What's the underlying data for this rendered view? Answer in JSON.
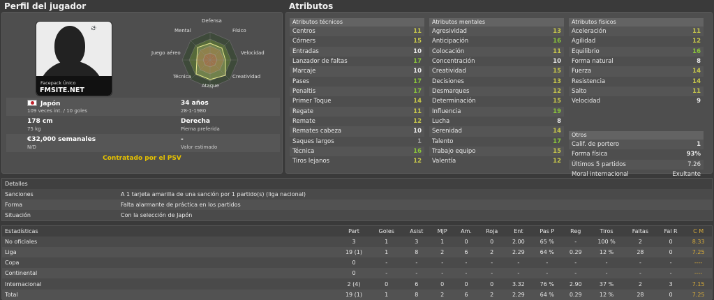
{
  "profile": {
    "title": "Perfil del jugador",
    "photo": {
      "caption_small": "Facepack  Único",
      "caption_big": "FMSITE.NET"
    },
    "radar": {
      "labels": {
        "defensa": "Defensa",
        "fisico": "Físico",
        "velocidad": "Velocidad",
        "creatividad": "Creatividad",
        "ataque": "Ataque",
        "tecnica": "Técnica",
        "juego_aereo": "Juego aéreo",
        "mental": "Mental"
      }
    },
    "nationality": "Japón",
    "caps": "109 veces int. / 10 goles",
    "age": "34 años",
    "birthdate": "28-1-1980",
    "height": "178 cm",
    "weight": "75 kg",
    "foot": "Derecha",
    "foot_label": "Pierna preferida",
    "wage": "€32,000 semanales",
    "wage_sub": "N/D",
    "value": "-",
    "value_label": "Valor estimado",
    "contract": "Contratado por el PSV"
  },
  "attributes": {
    "title": "Atributos",
    "technical": {
      "header": "Atributos técnicos",
      "items": [
        {
          "name": "Centros",
          "value": "11",
          "color": "#c8c84a"
        },
        {
          "name": "Córners",
          "value": "15",
          "color": "#c8c84a"
        },
        {
          "name": "Entradas",
          "value": "10",
          "color": "#e8e8e8"
        },
        {
          "name": "Lanzador de faltas",
          "value": "17",
          "color": "#8ac43a"
        },
        {
          "name": "Marcaje",
          "value": "10",
          "color": "#e8e8e8"
        },
        {
          "name": "Pases",
          "value": "17",
          "color": "#8ac43a"
        },
        {
          "name": "Penaltis",
          "value": "17",
          "color": "#8ac43a"
        },
        {
          "name": "Primer Toque",
          "value": "14",
          "color": "#c8c84a"
        },
        {
          "name": "Regate",
          "value": "11",
          "color": "#c8c84a"
        },
        {
          "name": "Remate",
          "value": "12",
          "color": "#c8c84a"
        },
        {
          "name": "Remates cabeza",
          "value": "10",
          "color": "#e8e8e8"
        },
        {
          "name": "Saques largos",
          "value": "1",
          "color": "#a0a0a0"
        },
        {
          "name": "Técnica",
          "value": "16",
          "color": "#8ac43a"
        },
        {
          "name": "Tiros lejanos",
          "value": "12",
          "color": "#c8c84a"
        }
      ]
    },
    "mental": {
      "header": "Atributos mentales",
      "items": [
        {
          "name": "Agresividad",
          "value": "13",
          "color": "#c8c84a"
        },
        {
          "name": "Anticipación",
          "value": "16",
          "color": "#8ac43a"
        },
        {
          "name": "Colocación",
          "value": "11",
          "color": "#c8c84a"
        },
        {
          "name": "Concentración",
          "value": "10",
          "color": "#e8e8e8"
        },
        {
          "name": "Creatividad",
          "value": "15",
          "color": "#c8c84a"
        },
        {
          "name": "Decisiones",
          "value": "13",
          "color": "#c8c84a"
        },
        {
          "name": "Desmarques",
          "value": "12",
          "color": "#c8c84a"
        },
        {
          "name": "Determinación",
          "value": "15",
          "color": "#c8c84a"
        },
        {
          "name": "Influencia",
          "value": "19",
          "color": "#8ac43a"
        },
        {
          "name": "Lucha",
          "value": "8",
          "color": "#e8e8e8"
        },
        {
          "name": "Serenidad",
          "value": "14",
          "color": "#c8c84a"
        },
        {
          "name": "Talento",
          "value": "17",
          "color": "#8ac43a"
        },
        {
          "name": "Trabajo equipo",
          "value": "15",
          "color": "#c8c84a"
        },
        {
          "name": "Valentía",
          "value": "12",
          "color": "#c8c84a"
        }
      ]
    },
    "physical": {
      "header": "Atributos físicos",
      "items": [
        {
          "name": "Aceleración",
          "value": "11",
          "color": "#c8c84a"
        },
        {
          "name": "Agilidad",
          "value": "12",
          "color": "#c8c84a"
        },
        {
          "name": "Equilibrio",
          "value": "16",
          "color": "#8ac43a"
        },
        {
          "name": "Forma natural",
          "value": "8",
          "color": "#e8e8e8"
        },
        {
          "name": "Fuerza",
          "value": "14",
          "color": "#c8c84a"
        },
        {
          "name": "Resistencia",
          "value": "14",
          "color": "#c8c84a"
        },
        {
          "name": "Salto",
          "value": "11",
          "color": "#c8c84a"
        },
        {
          "name": "Velocidad",
          "value": "9",
          "color": "#e8e8e8"
        }
      ]
    },
    "others": {
      "header": "Otros",
      "items": [
        {
          "name": "Calif. de portero",
          "value": "1"
        },
        {
          "name": "Forma física",
          "value": "93%"
        },
        {
          "name": "Últimos 5 partidos",
          "value": "7.26"
        },
        {
          "name": "Moral internacional",
          "value": "Exultante"
        }
      ]
    }
  },
  "details": {
    "header": "Detalles",
    "rows": [
      {
        "key": "Sanciones",
        "value": "A 1 tarjeta amarilla de una sanción por 1 partido(s) (liga nacional)"
      },
      {
        "key": "Forma",
        "value": "Falta alarmante de práctica en los partidos"
      },
      {
        "key": "Situación",
        "value": "Con la selección de Japón"
      }
    ]
  },
  "stats": {
    "columns": [
      "Estadísticas",
      "Part",
      "Goles",
      "Asist",
      "MJP",
      "Am.",
      "Roja",
      "Ent",
      "Pas P",
      "Reg",
      "Tiros",
      "Faltas",
      "Fal R",
      "C M"
    ],
    "rows": [
      [
        "No oficiales",
        "3",
        "1",
        "3",
        "1",
        "0",
        "0",
        "2.00",
        "65 %",
        "-",
        "100 %",
        "2",
        "0",
        "8.33"
      ],
      [
        "Liga",
        "19 (1)",
        "1",
        "8",
        "2",
        "6",
        "2",
        "2.29",
        "64 %",
        "0.29",
        "12 %",
        "28",
        "0",
        "7.25"
      ],
      [
        "Copa",
        "0",
        "-",
        "-",
        "-",
        "-",
        "-",
        "-",
        "-",
        "-",
        "-",
        "-",
        "-",
        "----"
      ],
      [
        "Continental",
        "0",
        "-",
        "-",
        "-",
        "-",
        "-",
        "-",
        "-",
        "-",
        "-",
        "-",
        "-",
        "----"
      ],
      [
        "Internacional",
        "2 (4)",
        "0",
        "6",
        "0",
        "0",
        "0",
        "3.32",
        "76 %",
        "2.90",
        "37 %",
        "2",
        "3",
        "7.15"
      ],
      [
        "Total",
        "19 (1)",
        "1",
        "8",
        "2",
        "6",
        "2",
        "2.29",
        "64 %",
        "0.29",
        "12 %",
        "28",
        "0",
        "7.25"
      ]
    ]
  }
}
